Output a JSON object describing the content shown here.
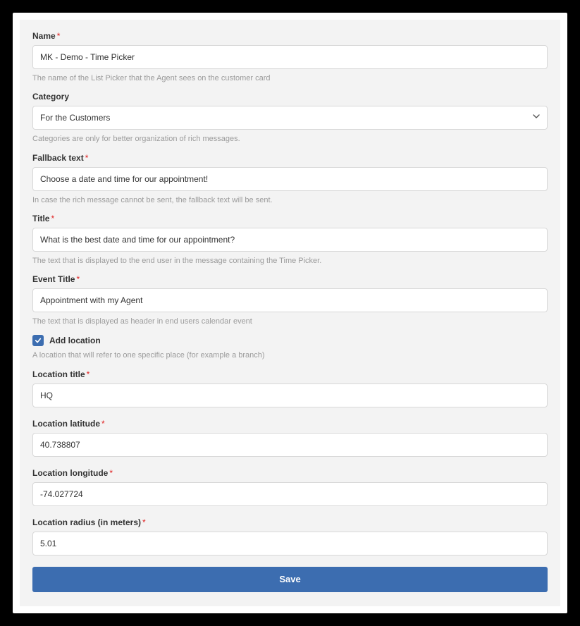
{
  "fields": {
    "name": {
      "label": "Name",
      "required": true,
      "value": "MK - Demo - Time Picker",
      "help": "The name of the List Picker that the Agent sees on the customer card"
    },
    "category": {
      "label": "Category",
      "required": false,
      "value": "For the Customers",
      "help": "Categories are only for better organization of rich messages."
    },
    "fallback": {
      "label": "Fallback text",
      "required": true,
      "value": "Choose a date and time for our appointment!",
      "help": "In case the rich message cannot be sent, the fallback text will be sent."
    },
    "title": {
      "label": "Title",
      "required": true,
      "value": "What is the best date and time for our appointment?",
      "help": "The text that is displayed to the end user in the message containing the Time Picker."
    },
    "eventTitle": {
      "label": "Event Title",
      "required": true,
      "value": "Appointment with my Agent",
      "help": "The text that is displayed as header in end users calendar event"
    },
    "addLocation": {
      "label": "Add location",
      "checked": true,
      "help": "A location that will refer to one specific place (for example a branch)"
    },
    "locationTitle": {
      "label": "Location title",
      "required": true,
      "value": "HQ"
    },
    "latitude": {
      "label": "Location latitude",
      "required": true,
      "value": "40.738807"
    },
    "longitude": {
      "label": "Location longitude",
      "required": true,
      "value": "-74.027724"
    },
    "radius": {
      "label": "Location radius (in meters)",
      "required": true,
      "value": "5.01"
    }
  },
  "buttons": {
    "save": "Save"
  },
  "asterisk": "*"
}
